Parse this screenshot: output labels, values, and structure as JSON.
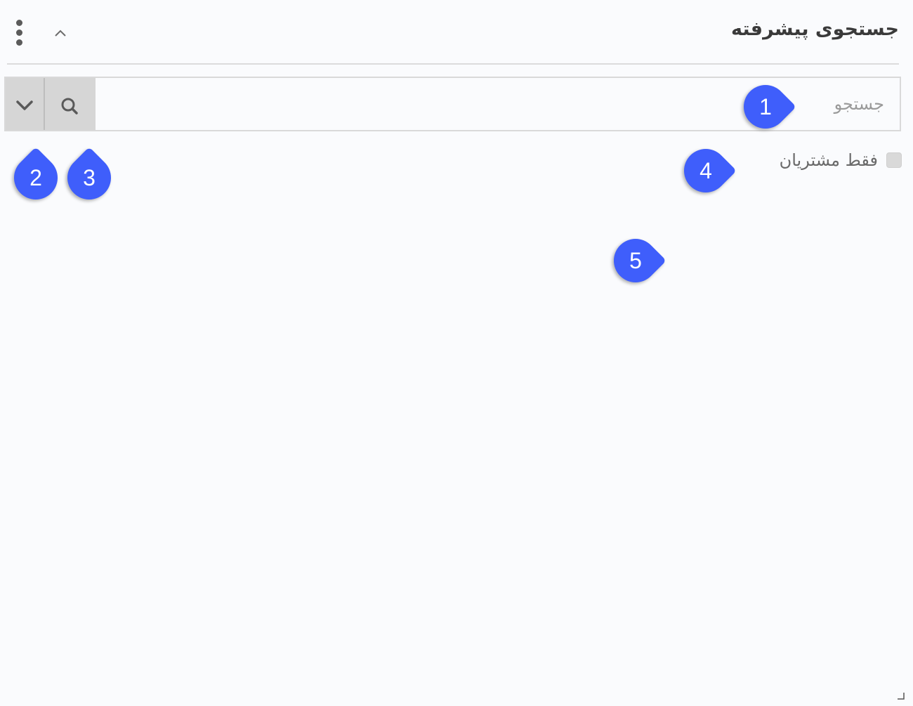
{
  "header": {
    "title": "جستجوی پیشرفته",
    "menu_icon": "more-vertical-icon",
    "collapse_icon": "chevron-up-icon"
  },
  "search": {
    "placeholder": "جستجو",
    "value": "",
    "dropdown_icon": "chevron-down-icon",
    "search_icon": "search-icon"
  },
  "filter": {
    "customers_only_label": "فقط مشتریان",
    "customers_only_checked": false
  },
  "markers": [
    "1",
    "2",
    "3",
    "4",
    "5"
  ],
  "colors": {
    "marker": "#3f5efb",
    "button_bg": "#d6d6d6",
    "title": "#3a3a3a"
  }
}
